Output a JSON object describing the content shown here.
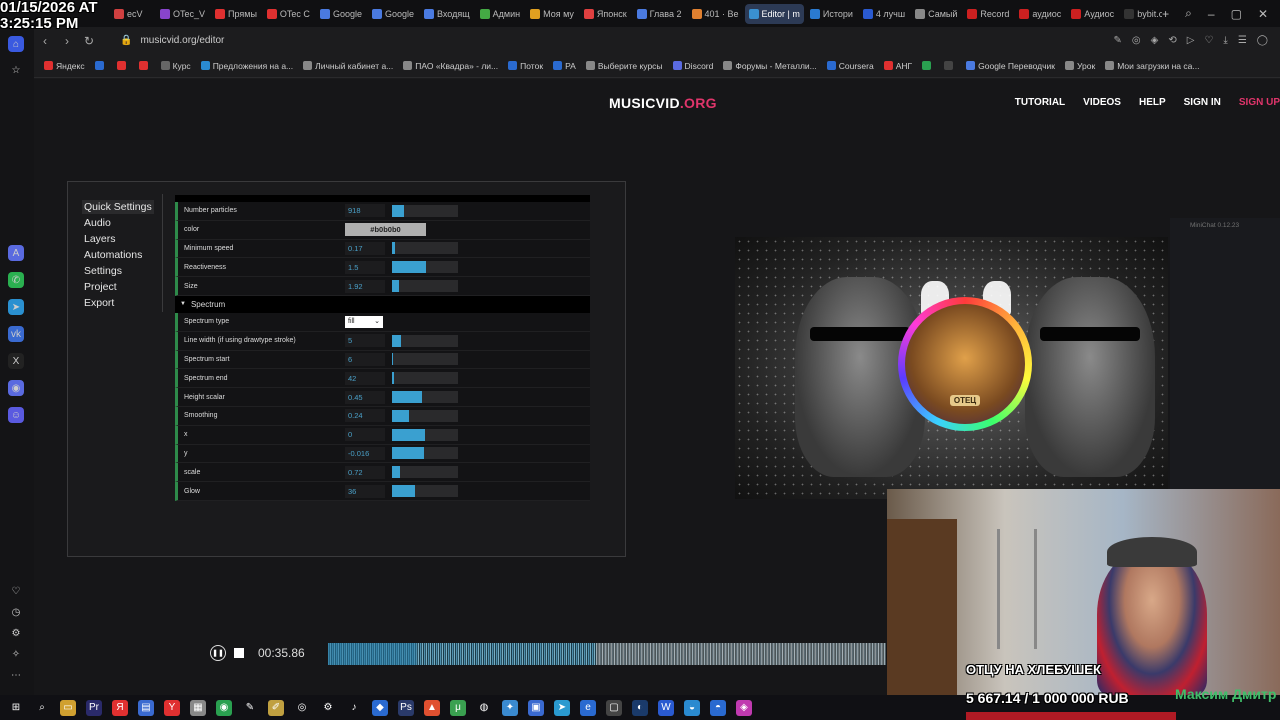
{
  "overlay": {
    "date": "01/15/2026 AT",
    "time": "3:25:15 PM"
  },
  "browser": {
    "tabs": [
      {
        "label": "ecV",
        "color": "#d04040"
      },
      {
        "label": "OTec_V",
        "color": "#8844cc"
      },
      {
        "label": "Прямы",
        "color": "#e03030"
      },
      {
        "label": "OTec C",
        "color": "#e03030"
      },
      {
        "label": "Google",
        "color": "#4a7ae0"
      },
      {
        "label": "Google",
        "color": "#4a7ae0"
      },
      {
        "label": "Входящ",
        "color": "#4a7ae0"
      },
      {
        "label": "Админ",
        "color": "#44aa44"
      },
      {
        "label": "Моя му",
        "color": "#e0a020"
      },
      {
        "label": "Японск",
        "color": "#e04040"
      },
      {
        "label": "Глава 2",
        "color": "#4a7ae0"
      },
      {
        "label": "401 · Ве",
        "color": "#e08030"
      },
      {
        "label": "Editor | m",
        "color": "#3a90d0",
        "active": true
      },
      {
        "label": "Истори",
        "color": "#2a7ad0"
      },
      {
        "label": "4 лучш",
        "color": "#2a5ad0"
      },
      {
        "label": "Самый",
        "color": "#888888"
      },
      {
        "label": "Record",
        "color": "#cc2020"
      },
      {
        "label": "аудиос",
        "color": "#cc2020"
      },
      {
        "label": "Аудиос",
        "color": "#cc2020"
      },
      {
        "label": "bybit.co",
        "color": "#333333"
      }
    ],
    "url": "musicvid.org/editor",
    "bookmarks": [
      {
        "label": "Яндекс",
        "color": "#e03030"
      },
      {
        "label": "",
        "color": "#2a6ad0"
      },
      {
        "label": "",
        "color": "#e03030"
      },
      {
        "label": "",
        "color": "#e03030"
      },
      {
        "label": "Курс",
        "color": "#666666"
      },
      {
        "label": "Предложения на а...",
        "color": "#2a8ad0"
      },
      {
        "label": "Личный кабинет а...",
        "color": "#888888"
      },
      {
        "label": "ПАО «Квадра» - ли...",
        "color": "#888888"
      },
      {
        "label": "Поток",
        "color": "#2a6ad0"
      },
      {
        "label": "РА",
        "color": "#2a6ad0"
      },
      {
        "label": "Выберите курсы",
        "color": "#888888"
      },
      {
        "label": "Discord",
        "color": "#5a6ae0"
      },
      {
        "label": "Форумы - Металли...",
        "color": "#888888"
      },
      {
        "label": "Coursera",
        "color": "#2a6ad0"
      },
      {
        "label": "АНГ",
        "color": "#e03030"
      },
      {
        "label": "",
        "color": "#2aa050"
      },
      {
        "label": "",
        "color": "#444444"
      },
      {
        "label": "Google Переводчик",
        "color": "#4a7ae0"
      },
      {
        "label": "Урок",
        "color": "#888888"
      },
      {
        "label": "Мои загрузки на са...",
        "color": "#888888"
      }
    ]
  },
  "site": {
    "brand_main": "MUSICVID",
    "brand_suffix": ".ORG",
    "nav": [
      "TUTORIAL",
      "VIDEOS",
      "HELP",
      "SIGN IN",
      "SIGN UP"
    ]
  },
  "editor": {
    "menu": [
      "Quick Settings",
      "Audio",
      "Layers",
      "Automations",
      "Settings",
      "Project",
      "Export"
    ],
    "particles": [
      {
        "label": "Number particles",
        "value": "918",
        "fill": 0.18
      },
      {
        "label": "color",
        "value": "#b0b0b0",
        "type": "color"
      },
      {
        "label": "Minimum speed",
        "value": "0.17",
        "fill": 0.05
      },
      {
        "label": "Reactiveness",
        "value": "1.5",
        "fill": 0.52
      },
      {
        "label": "Size",
        "value": "1.92",
        "fill": 0.1
      }
    ],
    "spectrum_section": "Spectrum",
    "spectrum": [
      {
        "label": "Spectrum type",
        "value": "fill",
        "type": "select"
      },
      {
        "label": "Line width (if using drawtype stroke)",
        "value": "5",
        "fill": 0.14
      },
      {
        "label": "Spectrum start",
        "value": "6",
        "fill": 0.0
      },
      {
        "label": "Spectrum end",
        "value": "42",
        "fill": 0.03
      },
      {
        "label": "Height scalar",
        "value": "0.45",
        "fill": 0.45
      },
      {
        "label": "Smoothing",
        "value": "0.24",
        "fill": 0.25
      },
      {
        "label": "x",
        "value": "0",
        "fill": 0.5
      },
      {
        "label": "y",
        "value": "-0.016",
        "fill": 0.49
      },
      {
        "label": "scale",
        "value": "0.72",
        "fill": 0.12
      },
      {
        "label": "Glow",
        "value": "36",
        "fill": 0.35
      }
    ]
  },
  "preview": {
    "avatar_label": "OTEЦ"
  },
  "minichat": {
    "title": "MiniChat 0.12.23"
  },
  "player": {
    "time": "00:35.86"
  },
  "stream": {
    "goal_title": "ОТЦУ НА ХЛЕБУШЕК",
    "goal_amount": "5 667.14 / 1 000 000 RUB",
    "streamer": "Максим Дмитр"
  }
}
